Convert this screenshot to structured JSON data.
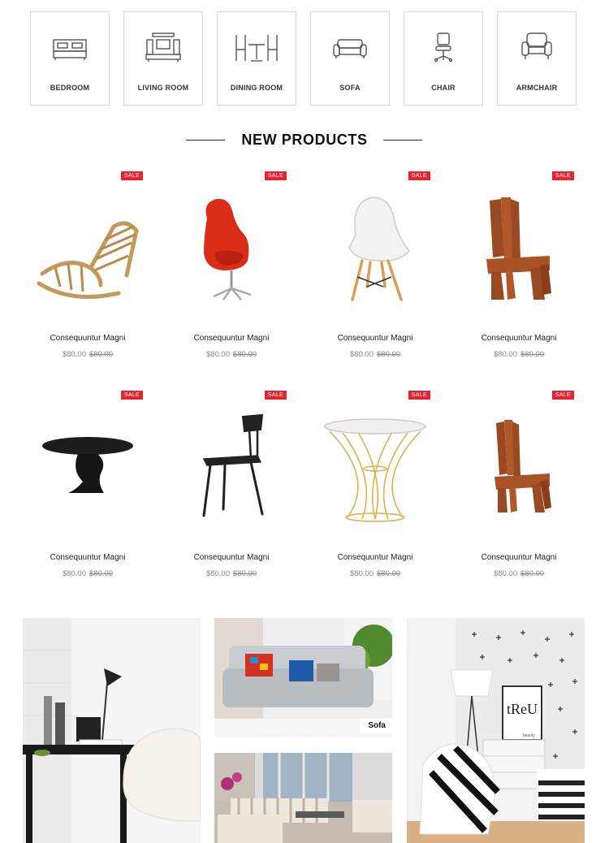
{
  "categories": [
    {
      "label": "BEDROOM",
      "icon": "bed-icon"
    },
    {
      "label": "LIVING ROOM",
      "icon": "tv-stand-icon"
    },
    {
      "label": "DINING ROOM",
      "icon": "dining-table-icon"
    },
    {
      "label": "SOFA",
      "icon": "sofa-icon"
    },
    {
      "label": "CHAIR",
      "icon": "office-chair-icon"
    },
    {
      "label": "ARMCHAIR",
      "icon": "armchair-icon"
    }
  ],
  "section": {
    "title": "NEW PRODUCTS"
  },
  "products": [
    {
      "badge": "SALE",
      "name": "Consequuntur Magni",
      "price": "$80.00",
      "old_price": "$80.00",
      "image": "wooden-rocking-chair"
    },
    {
      "badge": "SALE",
      "name": "Consequuntur Magni",
      "price": "$80.00",
      "old_price": "$80.00",
      "image": "red-egg-chair"
    },
    {
      "badge": "SALE",
      "name": "Consequuntur Magni",
      "price": "$80.00",
      "old_price": "$80.00",
      "image": "white-eames-chair"
    },
    {
      "badge": "SALE",
      "name": "Consequuntur Magni",
      "price": "$80.00",
      "old_price": "$80.00",
      "image": "wooden-sculpture-chair"
    },
    {
      "badge": "SALE",
      "name": "Consequuntur Magni",
      "price": "$80.00",
      "old_price": "$80.00",
      "image": "black-oval-table"
    },
    {
      "badge": "SALE",
      "name": "Consequuntur Magni",
      "price": "$80.00",
      "old_price": "$80.00",
      "image": "black-spindle-chair"
    },
    {
      "badge": "SALE",
      "name": "Consequuntur Magni",
      "price": "$80.00",
      "old_price": "$80.00",
      "image": "gold-wire-side-table"
    },
    {
      "badge": "SALE",
      "name": "Consequuntur Magni",
      "price": "$80.00",
      "old_price": "$80.00",
      "image": "wooden-sculpture-chair"
    }
  ],
  "banners": {
    "sofa_label": "Sofa",
    "poster_text": "tReU",
    "poster_caption": "beauty"
  },
  "colors": {
    "sale_badge": "#e8232d",
    "border": "#d6d6d6",
    "text": "#222222",
    "muted": "#888888"
  }
}
